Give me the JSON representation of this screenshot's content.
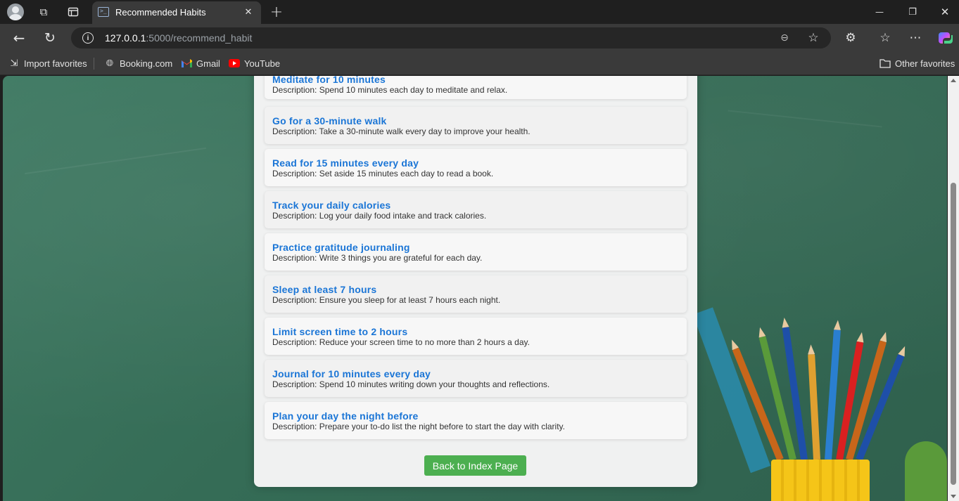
{
  "browser": {
    "tab_title": "Recommended Habits",
    "tab_close": "✕",
    "new_tab": "+",
    "url_host": "127.0.0.1",
    "url_path": ":5000/recommend_habit",
    "window_controls": {
      "minimize": "—",
      "restore": "❐",
      "close": "✕"
    }
  },
  "favorites": {
    "items": [
      {
        "label": "Import favorites",
        "icon": "import-icon"
      },
      {
        "label": "Booking.com",
        "icon": "globe-icon"
      },
      {
        "label": "Gmail",
        "icon": "gmail-icon"
      },
      {
        "label": "YouTube",
        "icon": "youtube-icon"
      }
    ],
    "other": "Other favorites"
  },
  "habits": [
    {
      "title": "Meditate for 10 minutes",
      "description": "Description: Spend 10 minutes each day to meditate and relax."
    },
    {
      "title": "Go for a 30-minute walk",
      "description": "Description: Take a 30-minute walk every day to improve your health."
    },
    {
      "title": "Read for 15 minutes every day",
      "description": "Description: Set aside 15 minutes each day to read a book."
    },
    {
      "title": "Track your daily calories",
      "description": "Description: Log your daily food intake and track calories."
    },
    {
      "title": "Practice gratitude journaling",
      "description": "Description: Write 3 things you are grateful for each day."
    },
    {
      "title": "Sleep at least 7 hours",
      "description": "Description: Ensure you sleep for at least 7 hours each night."
    },
    {
      "title": "Limit screen time to 2 hours",
      "description": "Description: Reduce your screen time to no more than 2 hours a day."
    },
    {
      "title": "Journal for 10 minutes every day",
      "description": "Description: Spend 10 minutes writing down your thoughts and reflections."
    },
    {
      "title": "Plan your day the night before",
      "description": "Description: Prepare your to-do list the night before to start the day with clarity."
    }
  ],
  "back_button": "Back to Index Page",
  "colors": {
    "habit_title": "#1a75d6",
    "button": "#4caf50",
    "chalkboard": "#356c56"
  }
}
